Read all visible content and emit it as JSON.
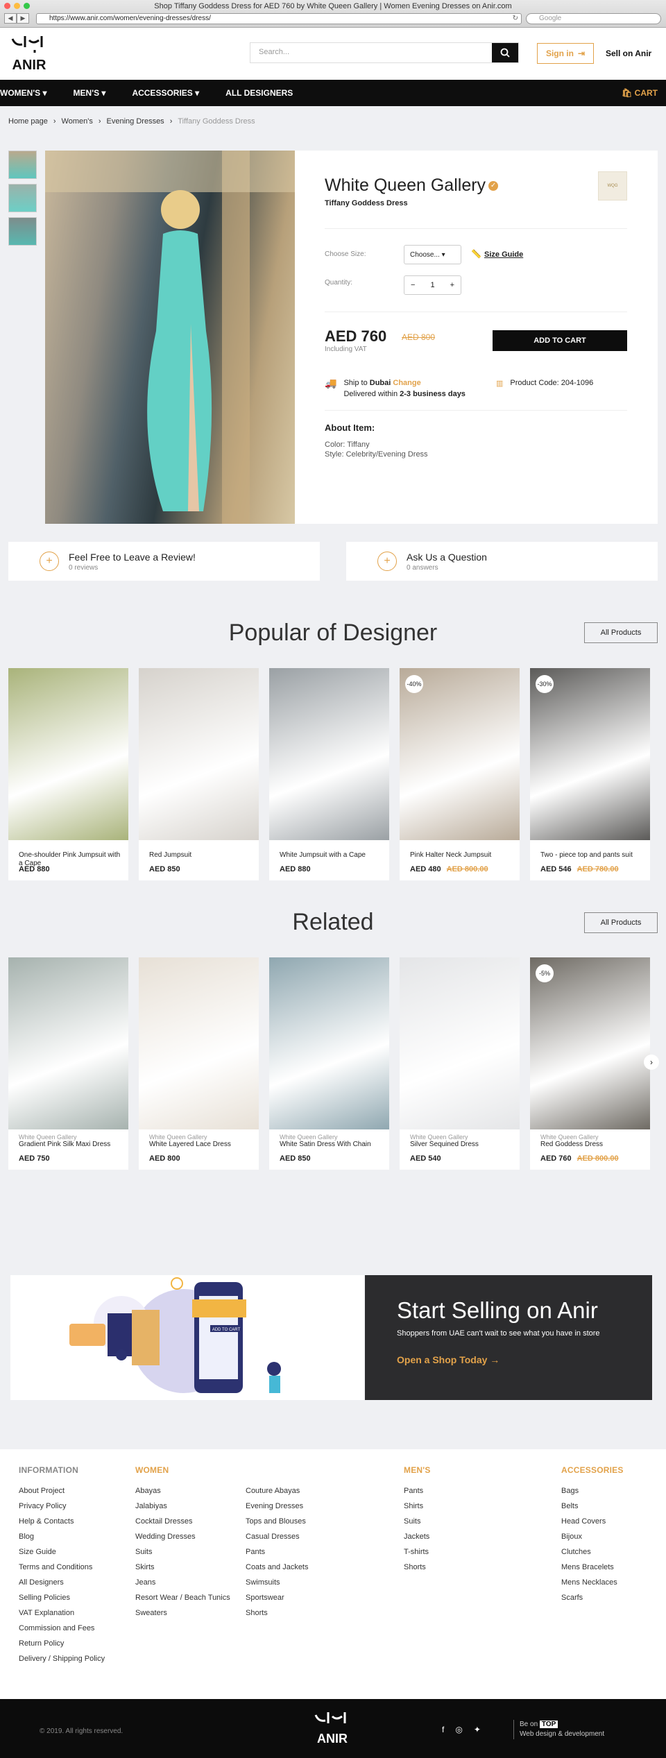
{
  "browser": {
    "title": "Shop Tiffany Goddess Dress for AED 760 by White Queen Gallery | Women Evening Dresses on Anir.com",
    "url": "https://www.anir.com/women/evening-dresses/dress/",
    "search_placeholder": "Google"
  },
  "header": {
    "logo_text": "ANIR",
    "search_placeholder": "Search...",
    "signin_label": "Sign in",
    "sell_label": "Sell on Anir"
  },
  "nav": {
    "items": [
      "WOMEN'S ▾",
      "MEN'S ▾",
      "ACCESSORIES ▾",
      "ALL DESIGNERS"
    ],
    "cart_label": "CART"
  },
  "breadcrumb": [
    "Home page",
    "Women's",
    "Evening Dresses",
    "Tiffany Goddess Dress"
  ],
  "product": {
    "brand": "White Queen Gallery",
    "name": "Tiffany Goddess Dress",
    "size_label": "Choose Size:",
    "size_value": "Choose...",
    "size_guide": "Size Guide",
    "qty_label": "Quantity:",
    "qty_value": "1",
    "price": "AED 760",
    "old_price": "AED 800",
    "vat": "Including VAT",
    "add_to_cart": "ADD TO CART",
    "ship_to": "Ship to",
    "ship_city": "Dubai",
    "ship_change": "Change",
    "delivered": "Delivered within",
    "delivery_days": "2-3 business days",
    "product_code": "Product Code: 204-1096",
    "about_title": "About Item:",
    "color": "Color: Tiffany",
    "style": "Style: Celebrity/Evening Dress"
  },
  "review": {
    "title": "Feel Free to Leave a Review!",
    "count": "0 reviews"
  },
  "question": {
    "title": "Ask Us a Question",
    "count": "0 answers"
  },
  "popular": {
    "title": "Popular of Designer",
    "all_label": "All Products",
    "items": [
      {
        "brand": "",
        "name": "One-shoulder Pink Jumpsuit with a Cape",
        "price": "AED 880",
        "old": "",
        "disc": "",
        "bg": "#a9b37a"
      },
      {
        "brand": "",
        "name": "Red Jumpsuit",
        "price": "AED 850",
        "old": "",
        "disc": "",
        "bg": "#d6d2cc"
      },
      {
        "brand": "",
        "name": "White Jumpsuit with a Cape",
        "price": "AED 880",
        "old": "",
        "disc": "",
        "bg": "#9aa0a4"
      },
      {
        "brand": "",
        "name": "Pink Halter Neck Jumpsuit",
        "price": "AED 480",
        "old": "AED 800.00",
        "disc": "-40%",
        "bg": "#b8aa98"
      },
      {
        "brand": "",
        "name": "Two - piece top and pants suit",
        "price": "AED 546",
        "old": "AED 780.00",
        "disc": "-30%",
        "bg": "#5b5a58"
      }
    ]
  },
  "related": {
    "title": "Related",
    "all_label": "All Products",
    "items": [
      {
        "brand": "White Queen Gallery",
        "name": "Gradient Pink Silk Maxi Dress",
        "price": "AED 750",
        "old": "",
        "disc": "",
        "bg": "#a6b2ae"
      },
      {
        "brand": "White Queen Gallery",
        "name": "White Layered Lace Dress",
        "price": "AED 800",
        "old": "",
        "disc": "",
        "bg": "#e7e0d6"
      },
      {
        "brand": "White Queen Gallery",
        "name": "White Satin Dress With Chain",
        "price": "AED 850",
        "old": "",
        "disc": "",
        "bg": "#8fa7b0"
      },
      {
        "brand": "White Queen Gallery",
        "name": "Silver Sequined Dress",
        "price": "AED 540",
        "old": "",
        "disc": "",
        "bg": "#e4e5e7"
      },
      {
        "brand": "White Queen Gallery",
        "name": "Red Goddess Dress",
        "price": "AED 760",
        "old": "AED 800.00",
        "disc": "-5%",
        "bg": "#6e6a63"
      }
    ]
  },
  "banner": {
    "title": "Start Selling on Anir",
    "subtitle": "Shoppers from UAE can't wait to see what you have in store",
    "cta": "Open a Shop Today →",
    "cart_tag": "ADD TO CART"
  },
  "footer": {
    "info_title": "INFORMATION",
    "info": [
      "About Project",
      "Privacy Policy",
      "Help & Contacts",
      "Blog",
      "Size Guide",
      "Terms and Conditions",
      "All Designers",
      "Selling Policies",
      "VAT Explanation",
      "Commission and Fees",
      "Return Policy",
      "Delivery / Shipping Policy"
    ],
    "women_title": "WOMEN",
    "women1": [
      "Abayas",
      "Jalabiyas",
      "Cocktail Dresses",
      "Wedding Dresses",
      "Suits",
      "Skirts",
      "Jeans",
      "Resort Wear / Beach Tunics",
      "Sweaters"
    ],
    "women2": [
      "Couture Abayas",
      "Evening Dresses",
      "Tops and Blouses",
      "Casual Dresses",
      "Pants",
      "Coats and Jackets",
      "Swimsuits",
      "Sportswear",
      "Shorts"
    ],
    "men_title": "MEN'S",
    "men": [
      "Pants",
      "Shirts",
      "Suits",
      "Jackets",
      "T-shirts",
      "Shorts"
    ],
    "acc_title": "ACCESSORIES",
    "acc": [
      "Bags",
      "Belts",
      "Head Covers",
      "Bijoux",
      "Clutches",
      "Mens Bracelets",
      "Mens Necklaces",
      "Scarfs"
    ]
  },
  "bottom": {
    "copyright": "© 2019. All rights reserved.",
    "beon_label": "Be on",
    "beon_top": "TOP",
    "beon_sub": "Web design & development"
  }
}
